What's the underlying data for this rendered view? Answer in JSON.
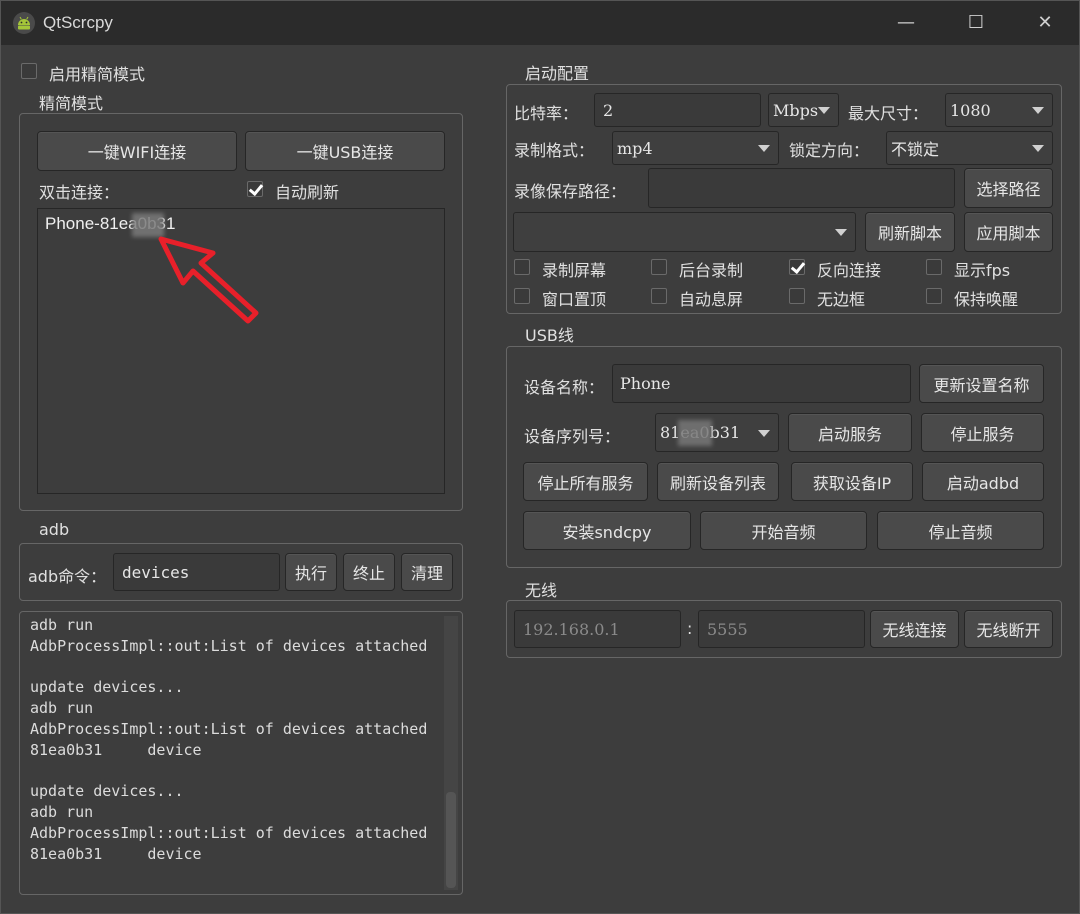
{
  "window": {
    "title": "QtScrcpy",
    "minimize": "—",
    "maximize": "☐",
    "close": "✕"
  },
  "simple_mode": {
    "toggle_label": "启用精简模式",
    "toggle_checked": false,
    "group_title": "精简模式",
    "wifi_button": "一键WIFI连接",
    "usb_button": "一键USB连接",
    "double_click_label": "双击连接：",
    "auto_refresh_label": "自动刷新",
    "auto_refresh_checked": true,
    "device_items": [
      "Phone-81ea0b31"
    ]
  },
  "adb": {
    "group_title": "adb",
    "command_label": "adb命令：",
    "command_value": "devices",
    "execute_button": "执行",
    "stop_button": "终止",
    "clear_button": "清理",
    "log_lines": [
      "adb run",
      "AdbProcessImpl::out:List of devices attached",
      "",
      "update devices...",
      "adb run",
      "AdbProcessImpl::out:List of devices attached",
      "81ea0b31     device",
      "",
      "update devices...",
      "adb run",
      "AdbProcessImpl::out:List of devices attached",
      "81ea0b31     device"
    ]
  },
  "launch_config": {
    "group_title": "启动配置",
    "bitrate_label": "比特率：",
    "bitrate_value": "2",
    "bitrate_unit": "Mbps",
    "max_size_label": "最大尺寸：",
    "max_size_value": "1080",
    "record_format_label": "录制格式：",
    "record_format_value": "mp4",
    "lock_orientation_label": "锁定方向：",
    "lock_orientation_value": "不锁定",
    "record_path_label": "录像保存路径：",
    "record_path_value": "",
    "select_path_button": "选择路径",
    "script_value": "",
    "refresh_script_button": "刷新脚本",
    "apply_script_button": "应用脚本",
    "options": [
      {
        "label": "录制屏幕",
        "checked": false
      },
      {
        "label": "后台录制",
        "checked": false
      },
      {
        "label": "反向连接",
        "checked": true
      },
      {
        "label": "显示fps",
        "checked": false
      },
      {
        "label": "窗口置顶",
        "checked": false
      },
      {
        "label": "自动息屏",
        "checked": false
      },
      {
        "label": "无边框",
        "checked": false
      },
      {
        "label": "保持唤醒",
        "checked": false
      }
    ]
  },
  "usb": {
    "group_title": "USB线",
    "device_name_label": "设备名称：",
    "device_name_value": "Phone",
    "update_name_button": "更新设置名称",
    "serial_label": "设备序列号：",
    "serial_value": "81ea0b31",
    "start_service_button": "启动服务",
    "stop_service_button": "停止服务",
    "stop_all_button": "停止所有服务",
    "refresh_devices_button": "刷新设备列表",
    "get_ip_button": "获取设备IP",
    "start_adbd_button": "启动adbd",
    "install_sndcpy_button": "安装sndcpy",
    "start_audio_button": "开始音频",
    "stop_audio_button": "停止音频"
  },
  "wireless": {
    "group_title": "无线",
    "ip_placeholder": "192.168.0.1",
    "colon": ":",
    "port_placeholder": "5555",
    "connect_button": "无线连接",
    "disconnect_button": "无线断开"
  },
  "colors": {
    "annotation_arrow": "#e8202a",
    "window_bg": "#3d3d3d",
    "titlebar_bg": "#2b2b2b"
  }
}
